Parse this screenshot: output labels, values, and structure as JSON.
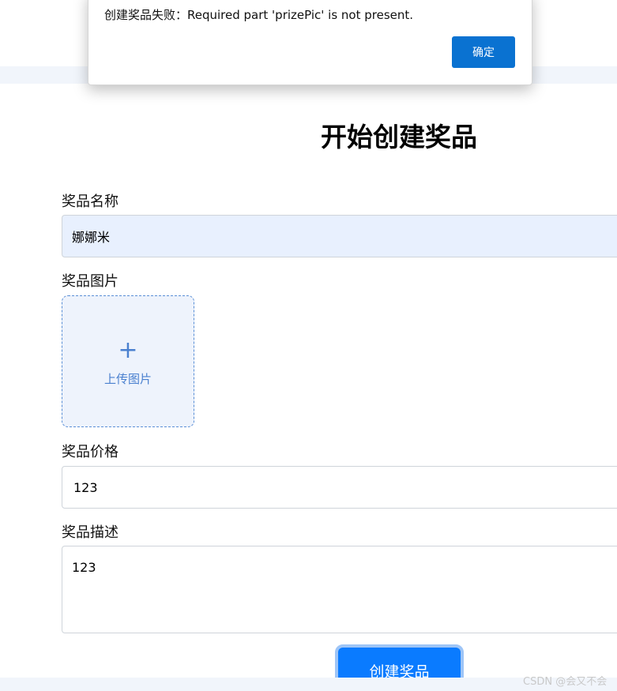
{
  "dialog": {
    "message": "创建奖品失败：Required part 'prizePic' is not present.",
    "ok_label": "确定"
  },
  "page_title": "开始创建奖品",
  "form": {
    "name_label": "奖品名称",
    "name_value": "娜娜米",
    "image_label": "奖品图片",
    "upload_plus": "+",
    "upload_text": "上传图片",
    "price_label": "奖品价格",
    "price_value": "123",
    "description_label": "奖品描述",
    "description_value": "123",
    "submit_label": "创建奖品"
  },
  "watermark": "CSDN @会又不会"
}
